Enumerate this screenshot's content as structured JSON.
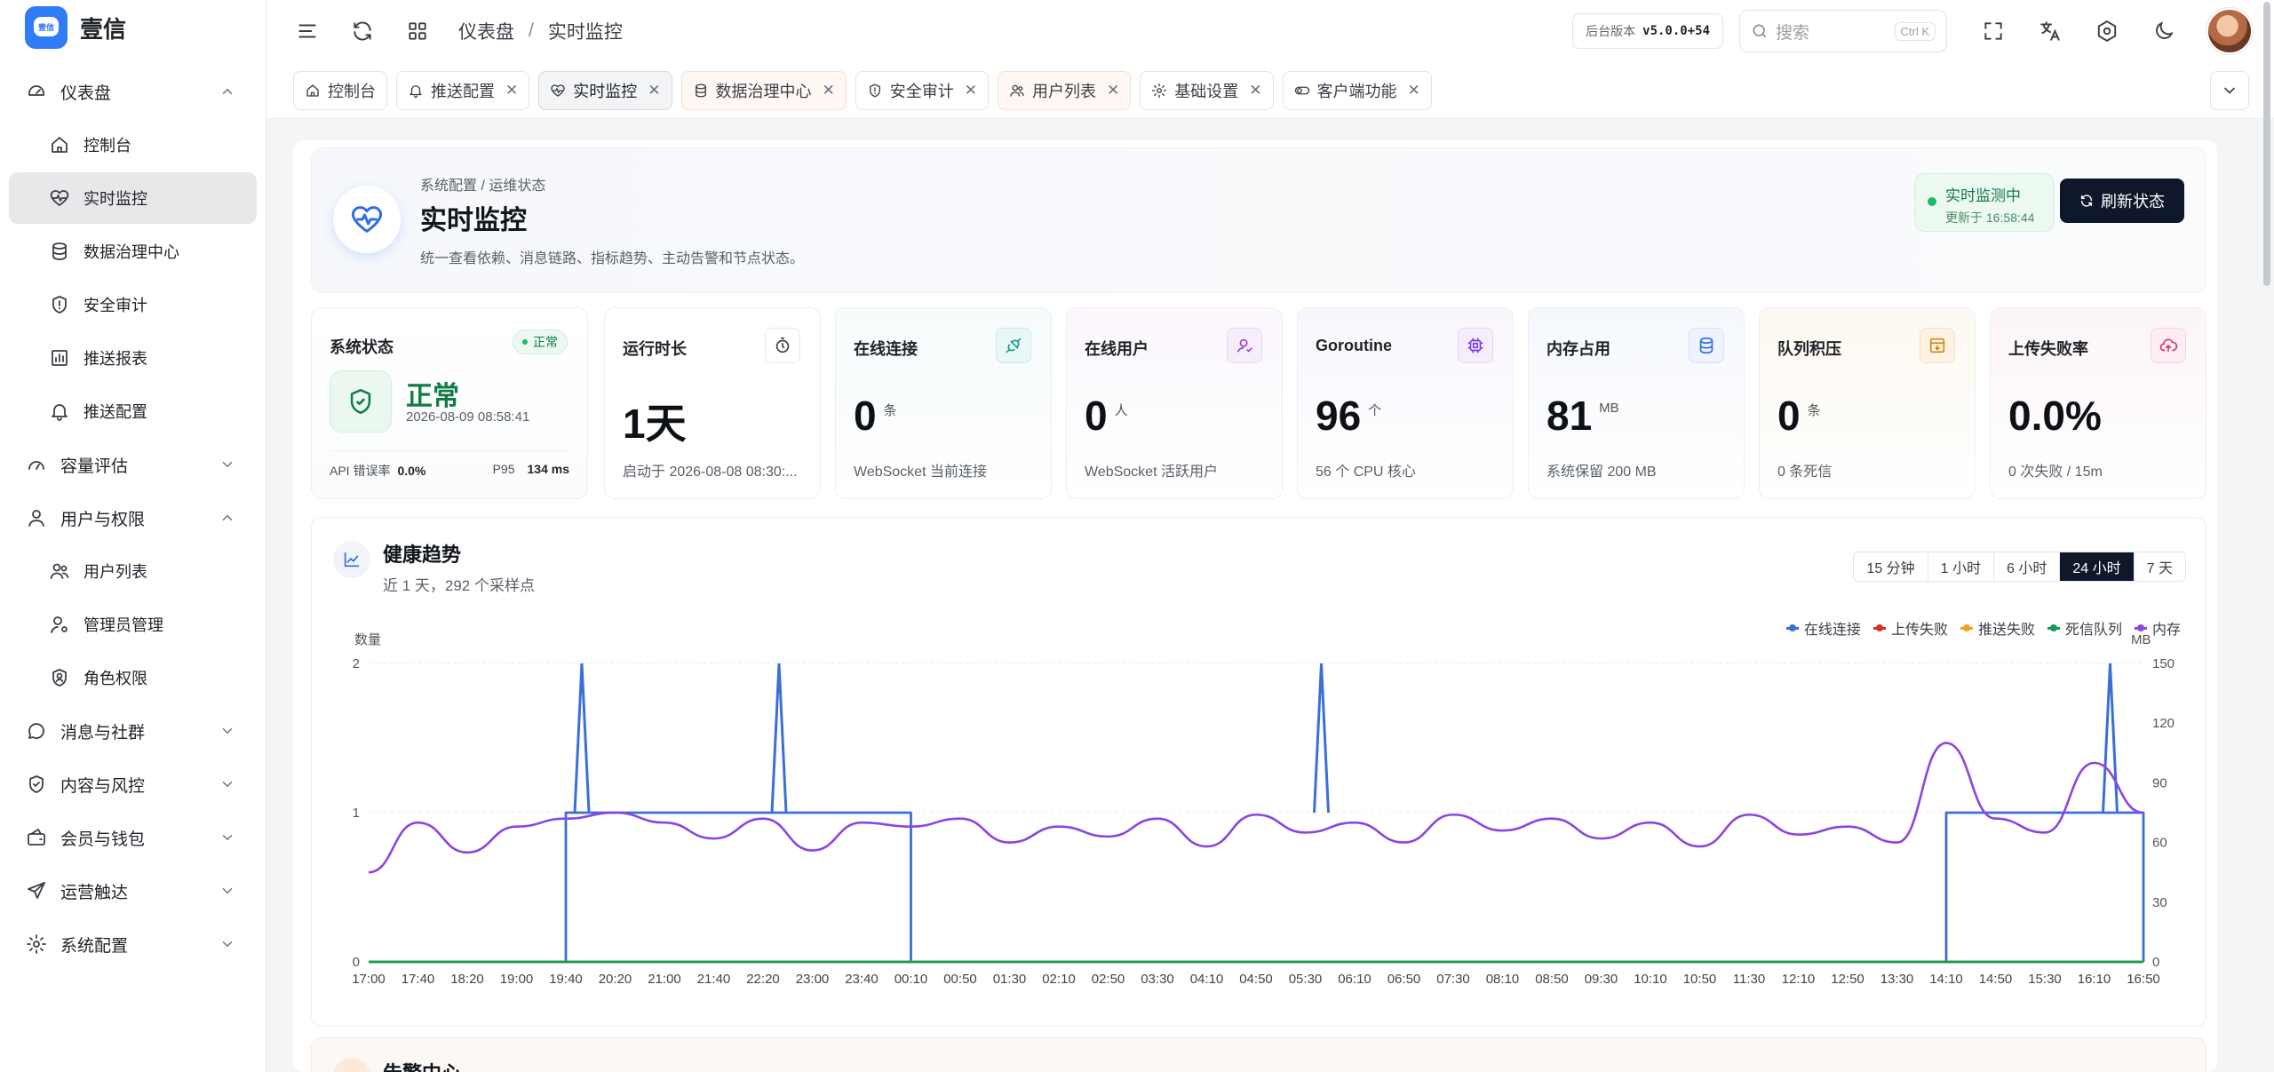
{
  "app": {
    "name": "壹信",
    "logo_text": "壹信"
  },
  "sidebar": {
    "items": [
      {
        "id": "dashboard",
        "label": "仪表盘",
        "icon": "dashboard-icon",
        "level": 0,
        "expanded": true
      },
      {
        "id": "console",
        "label": "控制台",
        "icon": "home-icon",
        "level": 1
      },
      {
        "id": "realtime",
        "label": "实时监控",
        "icon": "heart-pulse-icon",
        "level": 1,
        "active": true
      },
      {
        "id": "datagov",
        "label": "数据治理中心",
        "icon": "database-icon",
        "level": 1
      },
      {
        "id": "audit",
        "label": "安全审计",
        "icon": "shield-icon",
        "level": 1
      },
      {
        "id": "pushreport",
        "label": "推送报表",
        "icon": "bar-chart-icon",
        "level": 1
      },
      {
        "id": "pushcfg",
        "label": "推送配置",
        "icon": "bell-icon",
        "level": 1
      },
      {
        "id": "capacity",
        "label": "容量评估",
        "icon": "gauge-icon",
        "level": 0,
        "expanded": false
      },
      {
        "id": "users",
        "label": "用户与权限",
        "icon": "user-icon",
        "level": 0,
        "expanded": true
      },
      {
        "id": "userlist",
        "label": "用户列表",
        "icon": "users-icon",
        "level": 1
      },
      {
        "id": "admins",
        "label": "管理员管理",
        "icon": "user-cog-icon",
        "level": 1
      },
      {
        "id": "roles",
        "label": "角色权限",
        "icon": "badge-icon",
        "level": 1
      },
      {
        "id": "msg",
        "label": "消息与社群",
        "icon": "message-icon",
        "level": 0,
        "expanded": false
      },
      {
        "id": "risk",
        "label": "内容与风控",
        "icon": "shield-check-icon",
        "level": 0,
        "expanded": false
      },
      {
        "id": "wallet",
        "label": "会员与钱包",
        "icon": "wallet-icon",
        "level": 0,
        "expanded": false
      },
      {
        "id": "ops",
        "label": "运营触达",
        "icon": "send-icon",
        "level": 0,
        "expanded": false
      },
      {
        "id": "settings",
        "label": "系统配置",
        "icon": "gear-icon",
        "level": 0,
        "expanded": false
      }
    ]
  },
  "header": {
    "breadcrumb": [
      "仪表盘",
      "实时监控"
    ],
    "version_label": "后台版本",
    "version_value": "v5.0.0+54",
    "search_placeholder": "搜索",
    "search_shortcut": "Ctrl K"
  },
  "tabs": [
    {
      "label": "控制台",
      "icon": "home-icon",
      "closable": false
    },
    {
      "label": "推送配置",
      "icon": "bell-icon",
      "closable": true
    },
    {
      "label": "实时监控",
      "icon": "heart-pulse-icon",
      "closable": true,
      "active": true
    },
    {
      "label": "数据治理中心",
      "icon": "database-icon",
      "closable": true,
      "tinted": true
    },
    {
      "label": "安全审计",
      "icon": "shield-icon",
      "closable": true
    },
    {
      "label": "用户列表",
      "icon": "users-icon",
      "closable": true,
      "tinted": true
    },
    {
      "label": "基础设置",
      "icon": "gear-icon",
      "closable": true
    },
    {
      "label": "客户端功能",
      "icon": "toggle-icon",
      "closable": true
    }
  ],
  "hero": {
    "crumb": "系统配置 / 运维状态",
    "title": "实时监控",
    "desc": "统一查看依赖、消息链路、指标趋势、主动告警和节点状态。",
    "live_label": "实时监测中",
    "live_updated": "更新于 16:58:44",
    "refresh_label": "刷新状态"
  },
  "cards": {
    "system": {
      "title": "系统状态",
      "badge": "正常",
      "value": "正常",
      "time": "2026-08-09 08:58:41",
      "api_err_label": "API 错误率",
      "api_err": "0.0%",
      "p95_label": "P95",
      "p95": "134 ms"
    },
    "uptime": {
      "title": "运行时长",
      "value": "1天",
      "unit": "",
      "sub": "启动于 2026-08-08 08:30:..."
    },
    "conn": {
      "title": "在线连接",
      "value": "0",
      "unit": "条",
      "sub": "WebSocket 当前连接"
    },
    "users": {
      "title": "在线用户",
      "value": "0",
      "unit": "人",
      "sub": "WebSocket 活跃用户"
    },
    "gor": {
      "title": "Goroutine",
      "value": "96",
      "unit": "个",
      "sub": "56 个 CPU 核心"
    },
    "mem": {
      "title": "内存占用",
      "value": "81",
      "unit": "MB",
      "sub": "系统保留 200 MB"
    },
    "queue": {
      "title": "队列积压",
      "value": "0",
      "unit": "条",
      "sub": "0 条死信"
    },
    "upfail": {
      "title": "上传失败率",
      "value": "0.0%",
      "unit": "",
      "sub": "0 次失败 / 15m"
    }
  },
  "trend": {
    "title": "健康趋势",
    "subtitle": "近 1 天，292 个采样点",
    "ranges": [
      "15 分钟",
      "1 小时",
      "6 小时",
      "24 小时",
      "7 天"
    ],
    "active_range": "24 小时"
  },
  "alert_center": {
    "title": "告警中心"
  },
  "colors": {
    "blue": "#3b6fd8",
    "red": "#d93025",
    "orange": "#f2a01c",
    "green": "#0f9d58",
    "purple": "#8b45e0",
    "dark": "#0f172a"
  },
  "chart_data": {
    "type": "line",
    "ylabel_left": "数量",
    "ylabel_right": "MB",
    "ylim_left": [
      0,
      2
    ],
    "ylim_right": [
      0,
      150
    ],
    "yticks_left": [
      0,
      1,
      2
    ],
    "yticks_right": [
      0,
      30,
      60,
      90,
      120,
      150
    ],
    "x": [
      "17:00",
      "17:40",
      "18:20",
      "19:00",
      "19:40",
      "20:20",
      "21:00",
      "21:40",
      "22:20",
      "23:00",
      "23:40",
      "00:10",
      "00:50",
      "01:30",
      "02:10",
      "02:50",
      "03:30",
      "04:10",
      "04:50",
      "05:30",
      "06:10",
      "06:50",
      "07:30",
      "08:10",
      "08:50",
      "09:30",
      "10:10",
      "10:50",
      "11:30",
      "12:10",
      "12:50",
      "13:30",
      "14:10",
      "14:50",
      "15:30",
      "16:10",
      "16:50"
    ],
    "legend": [
      "在线连接",
      "上传失败",
      "推送失败",
      "死信队列",
      "内存"
    ],
    "series": [
      {
        "name": "在线连接",
        "axis": "left",
        "values": [
          0,
          0,
          0,
          0,
          1,
          1,
          1,
          1,
          1,
          1,
          1,
          0,
          0,
          0,
          0,
          0,
          0,
          0,
          0,
          0,
          0,
          0,
          0,
          0,
          0,
          0,
          0,
          0,
          0,
          0,
          0,
          0,
          1,
          1,
          1,
          1,
          0
        ],
        "spikes": [
          {
            "x": "19:40",
            "value": 2
          },
          {
            "x": "22:20",
            "value": 2
          },
          {
            "x": "05:30",
            "value": 2
          },
          {
            "x": "16:10",
            "value": 2
          }
        ]
      },
      {
        "name": "上传失败",
        "axis": "left",
        "values": [
          0,
          0,
          0,
          0,
          0,
          0,
          0,
          0,
          0,
          0,
          0,
          0,
          0,
          0,
          0,
          0,
          0,
          0,
          0,
          0,
          0,
          0,
          0,
          0,
          0,
          0,
          0,
          0,
          0,
          0,
          0,
          0,
          0,
          0,
          0,
          0,
          0
        ]
      },
      {
        "name": "推送失败",
        "axis": "left",
        "values": [
          0,
          0,
          0,
          0,
          0,
          0,
          0,
          0,
          0,
          0,
          0,
          0,
          0,
          0,
          0,
          0,
          0,
          0,
          0,
          0,
          0,
          0,
          0,
          0,
          0,
          0,
          0,
          0,
          0,
          0,
          0,
          0,
          0,
          0,
          0,
          0,
          0
        ]
      },
      {
        "name": "死信队列",
        "axis": "left",
        "values": [
          0,
          0,
          0,
          0,
          0,
          0,
          0,
          0,
          0,
          0,
          0,
          0,
          0,
          0,
          0,
          0,
          0,
          0,
          0,
          0,
          0,
          0,
          0,
          0,
          0,
          0,
          0,
          0,
          0,
          0,
          0,
          0,
          0,
          0,
          0,
          0,
          0
        ]
      },
      {
        "name": "内存",
        "axis": "right",
        "values": [
          45,
          70,
          55,
          68,
          72,
          75,
          70,
          62,
          72,
          56,
          70,
          68,
          72,
          60,
          68,
          63,
          72,
          58,
          74,
          65,
          70,
          60,
          74,
          66,
          72,
          62,
          70,
          58,
          74,
          64,
          68,
          60,
          110,
          72,
          65,
          100,
          75
        ]
      }
    ]
  }
}
